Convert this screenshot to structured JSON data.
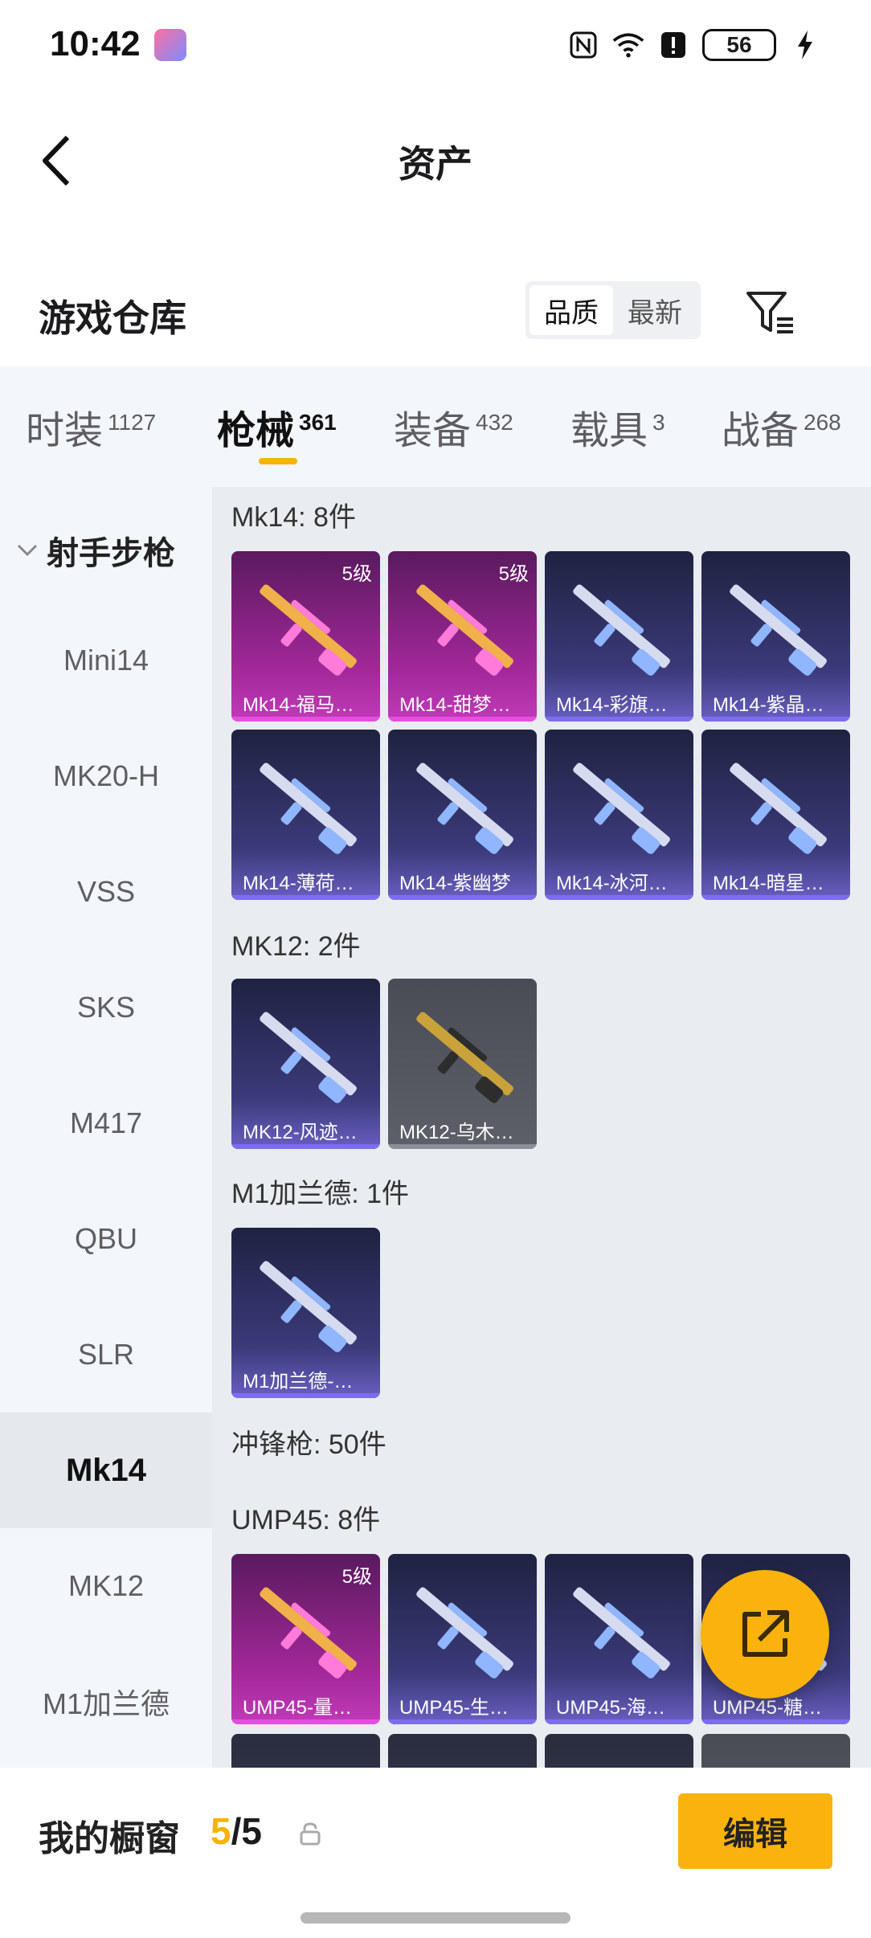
{
  "status_bar": {
    "time": "10:42",
    "battery": "56"
  },
  "header": {
    "title": "资产"
  },
  "section": {
    "title": "游戏仓库",
    "sort_options": [
      "品质",
      "最新"
    ]
  },
  "category_tabs": [
    {
      "label": "时装",
      "count": "1127"
    },
    {
      "label": "枪械",
      "count": "361"
    },
    {
      "label": "装备",
      "count": "432"
    },
    {
      "label": "载具",
      "count": "3"
    },
    {
      "label": "战备",
      "count": "268"
    }
  ],
  "side_menu": {
    "header": "射手步枪",
    "items": [
      "Mini14",
      "MK20-H",
      "VSS",
      "SKS",
      "M417",
      "QBU",
      "SLR",
      "Mk14",
      "MK12",
      "M1加兰德"
    ],
    "active": "Mk14"
  },
  "groups": [
    {
      "label": "Mk14: 8件",
      "items": [
        {
          "name": "Mk14-福马…",
          "level": "5级",
          "quality": "purple"
        },
        {
          "name": "Mk14-甜梦…",
          "level": "5级",
          "quality": "purple"
        },
        {
          "name": "Mk14-彩旗…",
          "quality": "blue"
        },
        {
          "name": "Mk14-紫晶…",
          "quality": "blue"
        },
        {
          "name": "Mk14-薄荷…",
          "quality": "blue"
        },
        {
          "name": "Mk14-紫幽梦",
          "quality": "blue"
        },
        {
          "name": "Mk14-冰河…",
          "quality": "blue"
        },
        {
          "name": "Mk14-暗星…",
          "quality": "blue"
        }
      ]
    },
    {
      "label": "MK12: 2件",
      "items": [
        {
          "name": "MK12-风迹…",
          "quality": "blue"
        },
        {
          "name": "MK12-乌木…",
          "quality": "gray"
        }
      ]
    },
    {
      "label": "M1加兰德: 1件",
      "items": [
        {
          "name": "M1加兰德-…",
          "quality": "blue"
        }
      ]
    },
    {
      "label": "冲锋枪: 50件"
    },
    {
      "label": "UMP45: 8件",
      "items": [
        {
          "name": "UMP45-量…",
          "level": "5级",
          "quality": "purple"
        },
        {
          "name": "UMP45-生…",
          "quality": "blue"
        },
        {
          "name": "UMP45-海…",
          "quality": "blue"
        },
        {
          "name": "UMP45-糖…",
          "quality": "blue"
        }
      ]
    }
  ],
  "bottom": {
    "label": "我的橱窗",
    "current": "5",
    "total": "/5",
    "edit": "编辑"
  },
  "colors": {
    "accent": "#f9b30c",
    "purple_quality": "#c13bb8",
    "blue_quality": "#6a5fc2"
  }
}
